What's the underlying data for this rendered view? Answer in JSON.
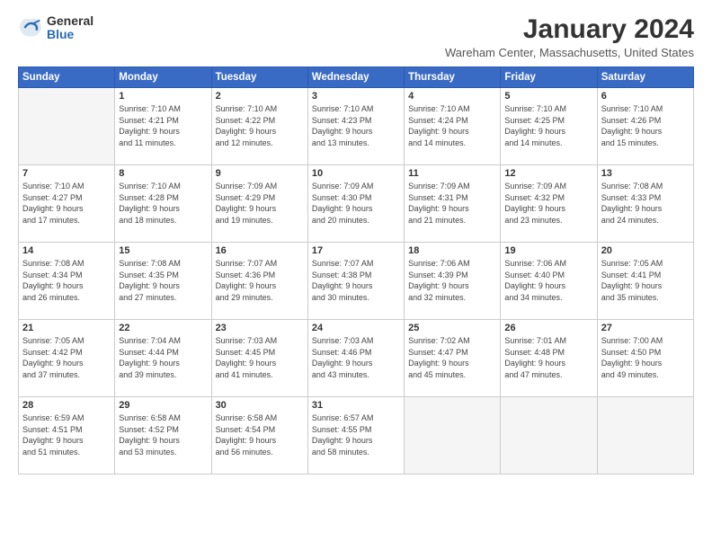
{
  "logo": {
    "general": "General",
    "blue": "Blue"
  },
  "header": {
    "title": "January 2024",
    "location": "Wareham Center, Massachusetts, United States"
  },
  "days_of_week": [
    "Sunday",
    "Monday",
    "Tuesday",
    "Wednesday",
    "Thursday",
    "Friday",
    "Saturday"
  ],
  "weeks": [
    [
      {
        "day": "",
        "info": ""
      },
      {
        "day": "1",
        "info": "Sunrise: 7:10 AM\nSunset: 4:21 PM\nDaylight: 9 hours\nand 11 minutes."
      },
      {
        "day": "2",
        "info": "Sunrise: 7:10 AM\nSunset: 4:22 PM\nDaylight: 9 hours\nand 12 minutes."
      },
      {
        "day": "3",
        "info": "Sunrise: 7:10 AM\nSunset: 4:23 PM\nDaylight: 9 hours\nand 13 minutes."
      },
      {
        "day": "4",
        "info": "Sunrise: 7:10 AM\nSunset: 4:24 PM\nDaylight: 9 hours\nand 14 minutes."
      },
      {
        "day": "5",
        "info": "Sunrise: 7:10 AM\nSunset: 4:25 PM\nDaylight: 9 hours\nand 14 minutes."
      },
      {
        "day": "6",
        "info": "Sunrise: 7:10 AM\nSunset: 4:26 PM\nDaylight: 9 hours\nand 15 minutes."
      }
    ],
    [
      {
        "day": "7",
        "info": "Sunrise: 7:10 AM\nSunset: 4:27 PM\nDaylight: 9 hours\nand 17 minutes."
      },
      {
        "day": "8",
        "info": "Sunrise: 7:10 AM\nSunset: 4:28 PM\nDaylight: 9 hours\nand 18 minutes."
      },
      {
        "day": "9",
        "info": "Sunrise: 7:09 AM\nSunset: 4:29 PM\nDaylight: 9 hours\nand 19 minutes."
      },
      {
        "day": "10",
        "info": "Sunrise: 7:09 AM\nSunset: 4:30 PM\nDaylight: 9 hours\nand 20 minutes."
      },
      {
        "day": "11",
        "info": "Sunrise: 7:09 AM\nSunset: 4:31 PM\nDaylight: 9 hours\nand 21 minutes."
      },
      {
        "day": "12",
        "info": "Sunrise: 7:09 AM\nSunset: 4:32 PM\nDaylight: 9 hours\nand 23 minutes."
      },
      {
        "day": "13",
        "info": "Sunrise: 7:08 AM\nSunset: 4:33 PM\nDaylight: 9 hours\nand 24 minutes."
      }
    ],
    [
      {
        "day": "14",
        "info": "Sunrise: 7:08 AM\nSunset: 4:34 PM\nDaylight: 9 hours\nand 26 minutes."
      },
      {
        "day": "15",
        "info": "Sunrise: 7:08 AM\nSunset: 4:35 PM\nDaylight: 9 hours\nand 27 minutes."
      },
      {
        "day": "16",
        "info": "Sunrise: 7:07 AM\nSunset: 4:36 PM\nDaylight: 9 hours\nand 29 minutes."
      },
      {
        "day": "17",
        "info": "Sunrise: 7:07 AM\nSunset: 4:38 PM\nDaylight: 9 hours\nand 30 minutes."
      },
      {
        "day": "18",
        "info": "Sunrise: 7:06 AM\nSunset: 4:39 PM\nDaylight: 9 hours\nand 32 minutes."
      },
      {
        "day": "19",
        "info": "Sunrise: 7:06 AM\nSunset: 4:40 PM\nDaylight: 9 hours\nand 34 minutes."
      },
      {
        "day": "20",
        "info": "Sunrise: 7:05 AM\nSunset: 4:41 PM\nDaylight: 9 hours\nand 35 minutes."
      }
    ],
    [
      {
        "day": "21",
        "info": "Sunrise: 7:05 AM\nSunset: 4:42 PM\nDaylight: 9 hours\nand 37 minutes."
      },
      {
        "day": "22",
        "info": "Sunrise: 7:04 AM\nSunset: 4:44 PM\nDaylight: 9 hours\nand 39 minutes."
      },
      {
        "day": "23",
        "info": "Sunrise: 7:03 AM\nSunset: 4:45 PM\nDaylight: 9 hours\nand 41 minutes."
      },
      {
        "day": "24",
        "info": "Sunrise: 7:03 AM\nSunset: 4:46 PM\nDaylight: 9 hours\nand 43 minutes."
      },
      {
        "day": "25",
        "info": "Sunrise: 7:02 AM\nSunset: 4:47 PM\nDaylight: 9 hours\nand 45 minutes."
      },
      {
        "day": "26",
        "info": "Sunrise: 7:01 AM\nSunset: 4:48 PM\nDaylight: 9 hours\nand 47 minutes."
      },
      {
        "day": "27",
        "info": "Sunrise: 7:00 AM\nSunset: 4:50 PM\nDaylight: 9 hours\nand 49 minutes."
      }
    ],
    [
      {
        "day": "28",
        "info": "Sunrise: 6:59 AM\nSunset: 4:51 PM\nDaylight: 9 hours\nand 51 minutes."
      },
      {
        "day": "29",
        "info": "Sunrise: 6:58 AM\nSunset: 4:52 PM\nDaylight: 9 hours\nand 53 minutes."
      },
      {
        "day": "30",
        "info": "Sunrise: 6:58 AM\nSunset: 4:54 PM\nDaylight: 9 hours\nand 56 minutes."
      },
      {
        "day": "31",
        "info": "Sunrise: 6:57 AM\nSunset: 4:55 PM\nDaylight: 9 hours\nand 58 minutes."
      },
      {
        "day": "",
        "info": ""
      },
      {
        "day": "",
        "info": ""
      },
      {
        "day": "",
        "info": ""
      }
    ]
  ]
}
